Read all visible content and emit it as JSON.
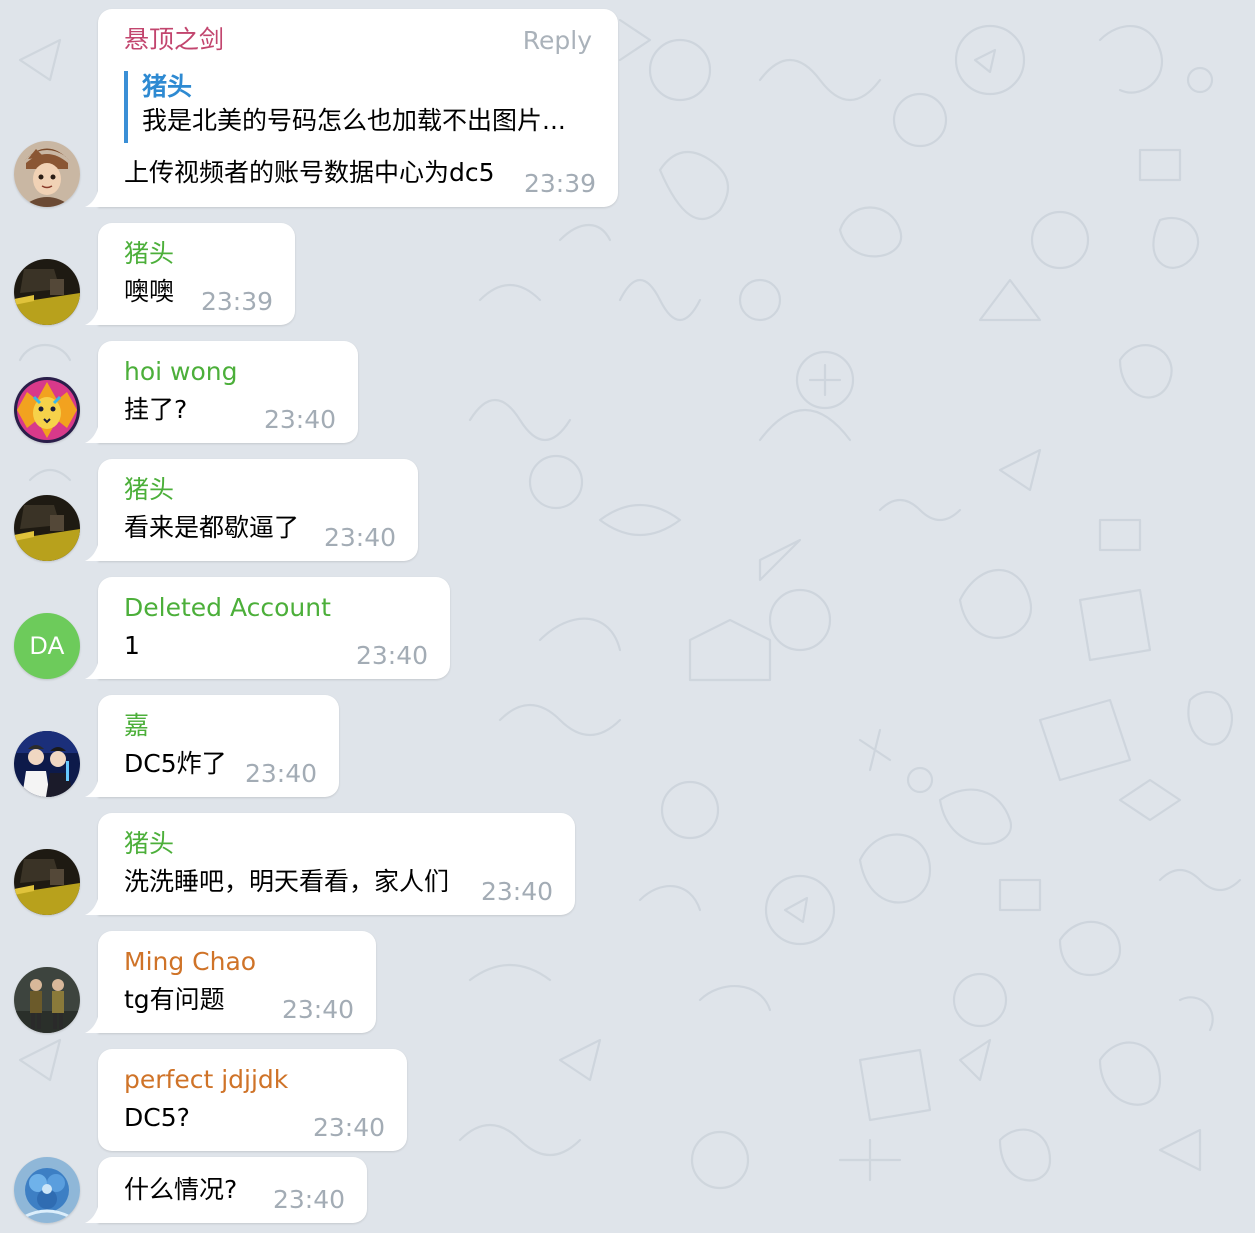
{
  "colors": {
    "background": "#dfe4ea",
    "bubble": "#ffffff",
    "timestamp": "#a3acb5",
    "quote_bar": "#3a8fd6"
  },
  "messages": [
    {
      "sender": "悬顶之剑",
      "sender_color": "#c2456e",
      "reply_label": "Reply",
      "quote": {
        "sender": "猪头",
        "text": "我是北美的号码怎么也加载不出图片..."
      },
      "text": "上传视频者的账号数据中心为dc5",
      "time": "23:39",
      "avatar_icon": "cartoon-character-avatar"
    },
    {
      "sender": "猪头",
      "sender_color": "#4caf3a",
      "text": "噢噢",
      "time": "23:39",
      "avatar_icon": "dark-photo-avatar"
    },
    {
      "sender": "hoi wong",
      "sender_color": "#4caf3a",
      "text": "挂了?",
      "time": "23:40",
      "avatar_icon": "colorful-lion-avatar"
    },
    {
      "sender": "猪头",
      "sender_color": "#4caf3a",
      "text": "看来是都歇逼了",
      "time": "23:40",
      "avatar_icon": "dark-photo-avatar"
    },
    {
      "sender": "Deleted Account",
      "sender_color": "#4caf3a",
      "text": "1",
      "time": "23:40",
      "avatar_initials": "DA",
      "avatar_color": "#6dcb5b"
    },
    {
      "sender": "嘉",
      "sender_color": "#4caf3a",
      "text": "DC5炸了",
      "time": "23:40",
      "avatar_icon": "two-people-photo-avatar"
    },
    {
      "sender": "猪头",
      "sender_color": "#4caf3a",
      "text": "洗洗睡吧，明天看看，家人们",
      "time": "23:40",
      "avatar_icon": "dark-photo-avatar"
    },
    {
      "sender": "Ming Chao",
      "sender_color": "#cf7328",
      "text": "tg有问题",
      "time": "23:40",
      "avatar_icon": "game-characters-avatar"
    },
    {
      "sender": "perfect jdjjdk",
      "sender_color": "#cf7328",
      "text": "DC5?",
      "time": "23:40"
    },
    {
      "text": "什么情况?",
      "time": "23:40",
      "avatar_icon": "blue-flower-avatar"
    }
  ]
}
